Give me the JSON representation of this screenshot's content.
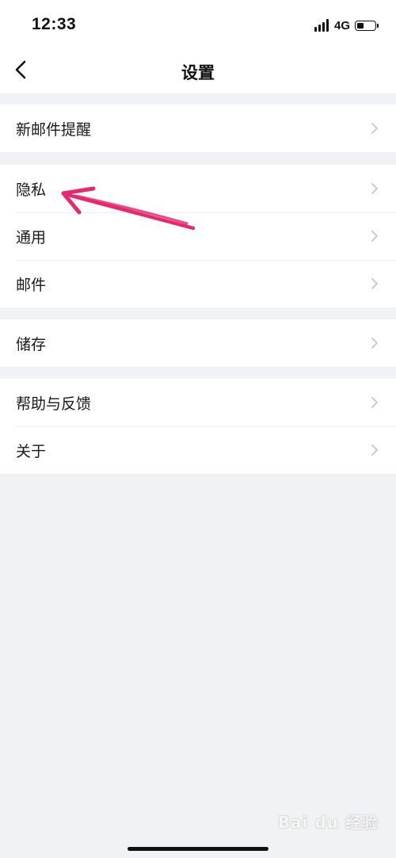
{
  "status_bar": {
    "time": "12:33",
    "network": "4G",
    "battery_level_percent": 40
  },
  "header": {
    "title": "设置",
    "back_icon": "chevron-left-icon"
  },
  "groups": [
    {
      "items": [
        {
          "label": "新邮件提醒"
        }
      ]
    },
    {
      "items": [
        {
          "label": "隐私"
        },
        {
          "label": "通用"
        },
        {
          "label": "邮件"
        }
      ]
    },
    {
      "items": [
        {
          "label": "储存"
        }
      ]
    },
    {
      "items": [
        {
          "label": "帮助与反馈"
        },
        {
          "label": "关于"
        }
      ]
    }
  ],
  "annotation": {
    "color": "#e8286e",
    "target": "隐私"
  },
  "watermark": {
    "text": "Bai du 经验"
  },
  "colors": {
    "page_background": "#f1f2f5",
    "card_background": "#ffffff",
    "chevron": "#c4c6cb"
  }
}
